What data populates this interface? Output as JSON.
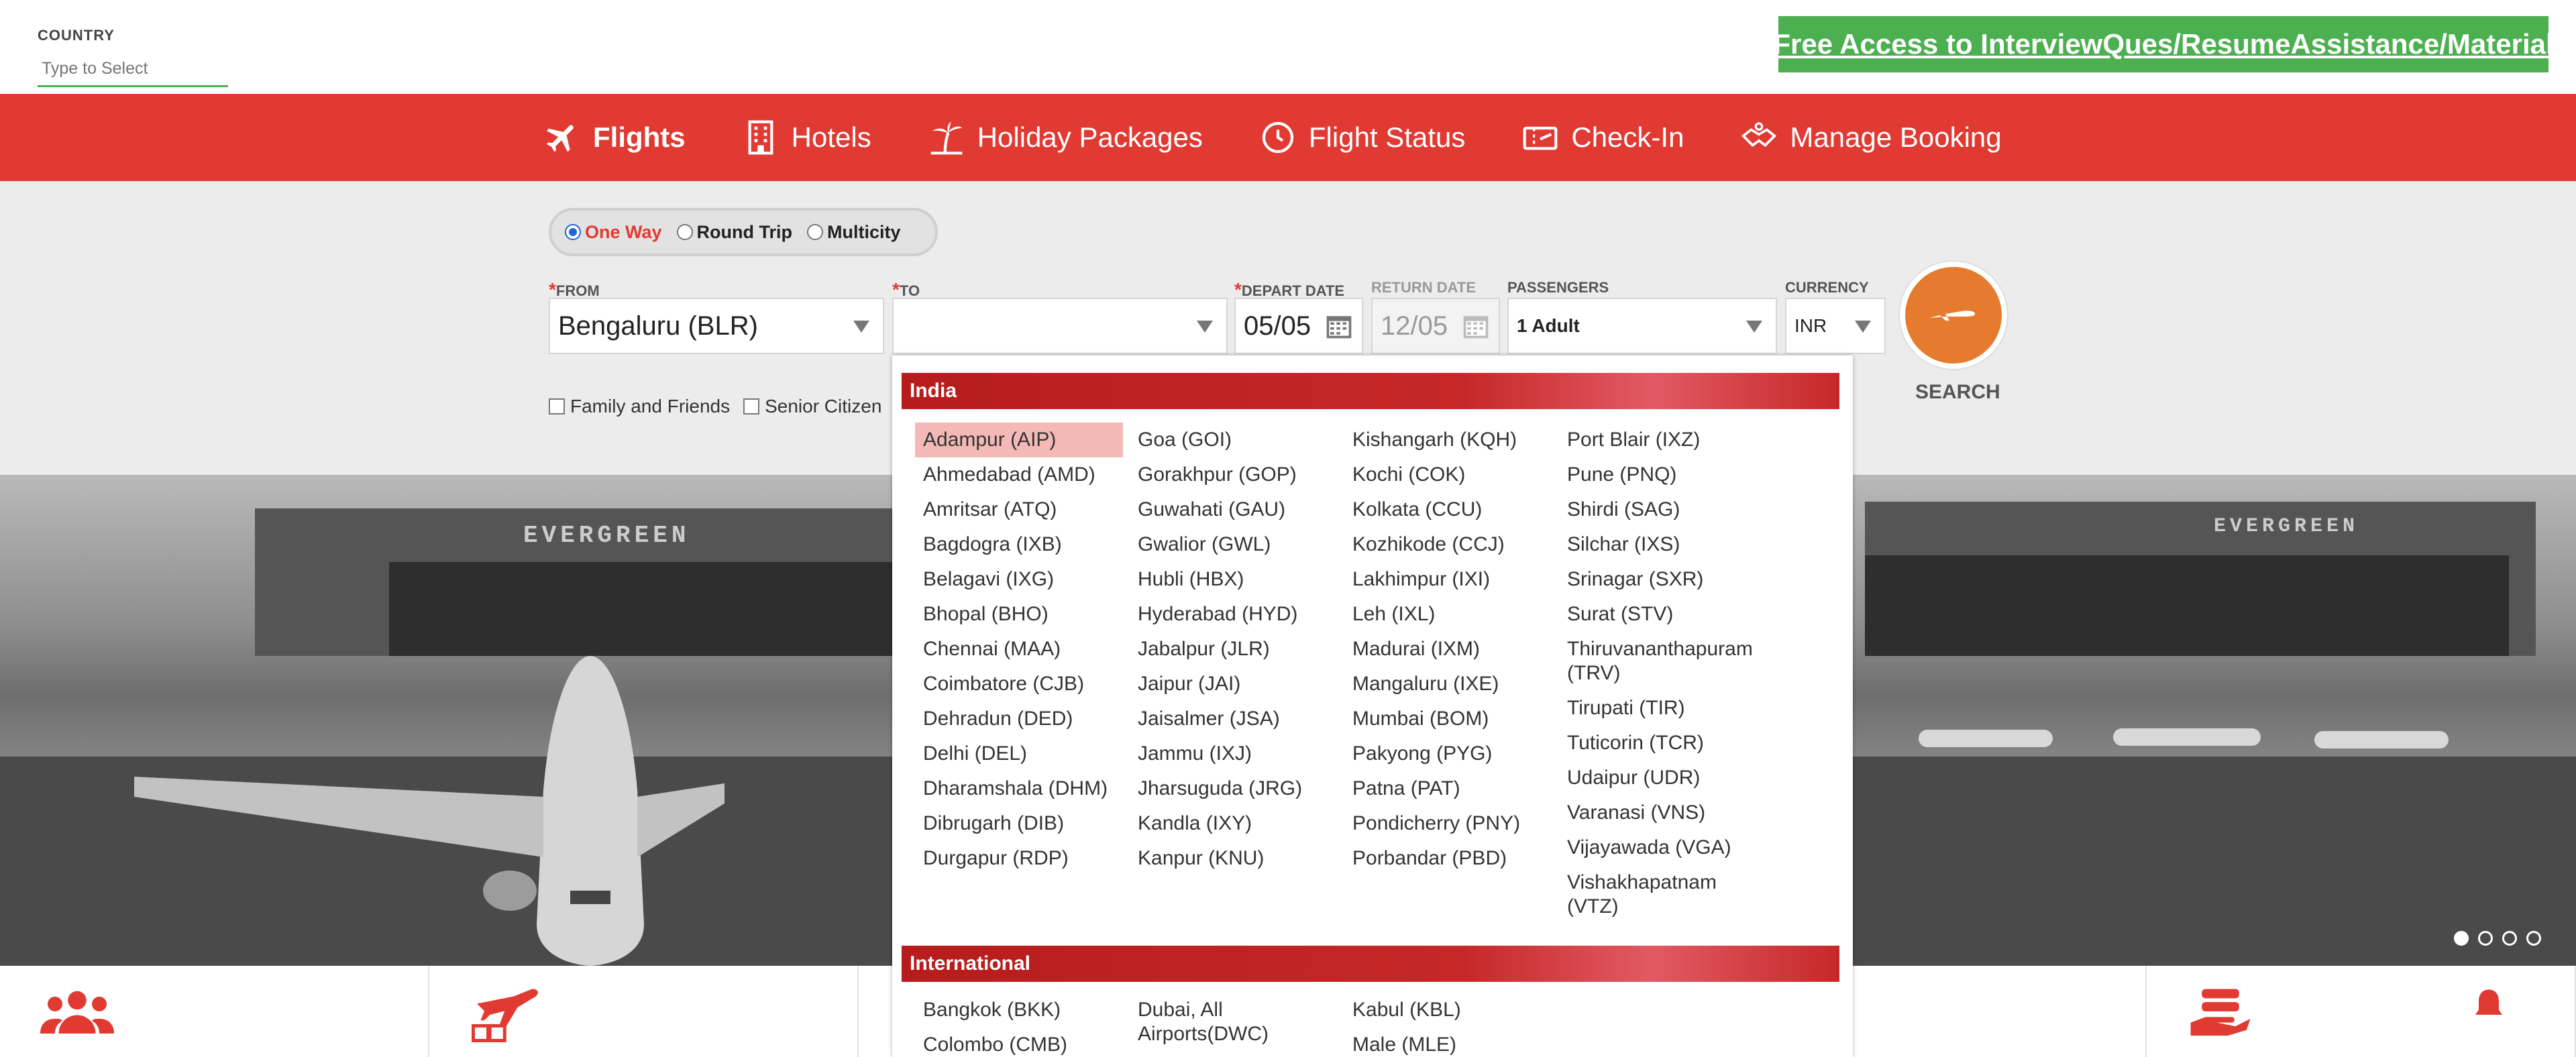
{
  "country": {
    "label": "COUNTRY",
    "placeholder": "Type to Select"
  },
  "promo": "Free Access to InterviewQues/ResumeAssistance/Material",
  "nav": [
    {
      "label": "Flights",
      "icon": "plane-icon"
    },
    {
      "label": "Hotels",
      "icon": "hotel-icon"
    },
    {
      "label": "Holiday Packages",
      "icon": "palm-tree-icon"
    },
    {
      "label": "Flight Status",
      "icon": "clock-icon"
    },
    {
      "label": "Check-In",
      "icon": "ticket-icon"
    },
    {
      "label": "Manage Booking",
      "icon": "handshake-icon"
    }
  ],
  "trip": {
    "one_way": "One Way",
    "round_trip": "Round Trip",
    "multicity": "Multicity",
    "selected": "One Way"
  },
  "form": {
    "from_label": "FROM",
    "from_value": "Bengaluru (BLR)",
    "to_label": "TO",
    "to_value": "",
    "depart_label": "DEPART DATE",
    "depart_value": "05/05",
    "return_label": "RETURN DATE",
    "return_value": "12/05",
    "passengers_label": "PASSENGERS",
    "passengers_value": "1 Adult",
    "currency_label": "CURRENCY",
    "currency_value": "INR",
    "search_label": "SEARCH",
    "family_label": "Family and Friends",
    "senior_label": "Senior Citizen"
  },
  "dropdown": {
    "india_title": "India",
    "india_cols": [
      [
        "Adampur (AIP)",
        "Ahmedabad (AMD)",
        "Amritsar (ATQ)",
        "Bagdogra (IXB)",
        "Belagavi (IXG)",
        "Bhopal (BHO)",
        "Chennai (MAA)",
        "Coimbatore (CJB)",
        "Dehradun (DED)",
        "Delhi (DEL)",
        "Dharamshala (DHM)",
        "Dibrugarh (DIB)",
        "Durgapur (RDP)"
      ],
      [
        "Goa (GOI)",
        "Gorakhpur (GOP)",
        "Guwahati (GAU)",
        "Gwalior (GWL)",
        "Hubli (HBX)",
        "Hyderabad (HYD)",
        "Jabalpur (JLR)",
        "Jaipur (JAI)",
        "Jaisalmer (JSA)",
        "Jammu (IXJ)",
        "Jharsuguda (JRG)",
        "Kandla (IXY)",
        "Kanpur (KNU)"
      ],
      [
        "Kishangarh (KQH)",
        "Kochi (COK)",
        "Kolkata (CCU)",
        "Kozhikode (CCJ)",
        "Lakhimpur (IXI)",
        "Leh (IXL)",
        "Madurai (IXM)",
        "Mangaluru (IXE)",
        "Mumbai (BOM)",
        "Pakyong (PYG)",
        "Patna (PAT)",
        "Pondicherry (PNY)",
        "Porbandar (PBD)"
      ],
      [
        "Port Blair (IXZ)",
        "Pune (PNQ)",
        "Shirdi (SAG)",
        "Silchar (IXS)",
        "Srinagar (SXR)",
        "Surat (STV)",
        "Thiruvananthapuram (TRV)",
        "Tirupati (TIR)",
        "Tuticorin (TCR)",
        "Udaipur (UDR)",
        "Varanasi (VNS)",
        "Vijayawada (VGA)",
        "Vishakhapatnam (VTZ)"
      ]
    ],
    "highlighted": "Adampur (AIP)",
    "intl_title": "International",
    "intl_cols": [
      [
        "Bangkok (BKK)",
        "Colombo (CMB)"
      ],
      [
        "Dubai, All Airports(DWC)"
      ],
      [
        "Kabul (KBL)",
        "Male (MLE)"
      ]
    ]
  },
  "hero": {
    "hangar_text": "EVERGREEN"
  },
  "colors": {
    "brand_red": "#e03a32",
    "promo_green": "#4caf50",
    "search_orange": "#e67a2e"
  }
}
